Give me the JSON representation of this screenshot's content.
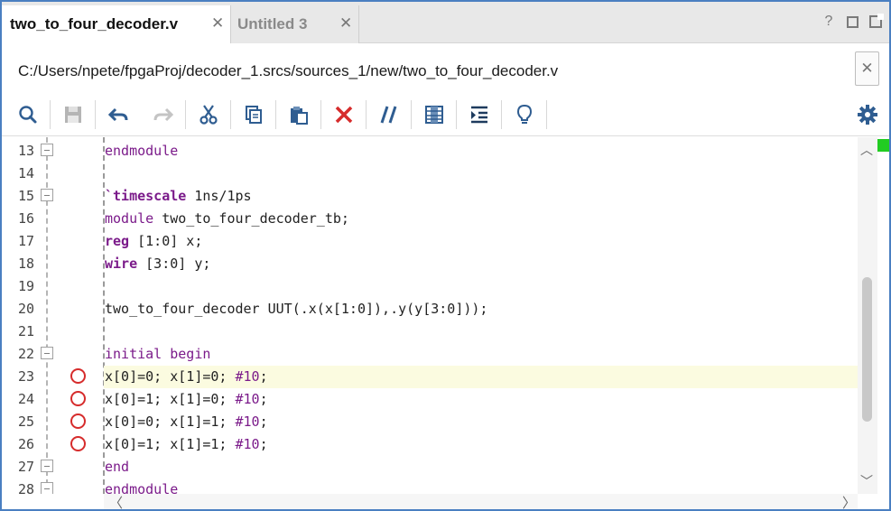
{
  "tabs": [
    {
      "label": "two_to_four_decoder.v",
      "active": true
    },
    {
      "label": "Untitled 3",
      "active": false
    }
  ],
  "window_buttons": {
    "help": "?"
  },
  "path": "C:/Users/npete/fpgaProj/decoder_1.srcs/sources_1/new/two_to_four_decoder.v",
  "toolbar": [
    {
      "name": "search-icon"
    },
    {
      "name": "save-icon"
    },
    {
      "name": "undo-icon"
    },
    {
      "name": "redo-icon"
    },
    {
      "name": "cut-icon"
    },
    {
      "name": "copy-icon"
    },
    {
      "name": "paste-icon"
    },
    {
      "name": "delete-icon"
    },
    {
      "name": "comment-icon"
    },
    {
      "name": "column-icon"
    },
    {
      "name": "indent-icon"
    },
    {
      "name": "lightbulb-icon"
    },
    {
      "name": "gear-icon"
    }
  ],
  "lines": [
    {
      "num": "13",
      "fold": true,
      "bp": false,
      "hl": false,
      "code": [
        [
          "kw",
          "endmodule"
        ]
      ]
    },
    {
      "num": "14",
      "fold": false,
      "bp": false,
      "hl": false,
      "code": []
    },
    {
      "num": "15",
      "fold": true,
      "bp": false,
      "hl": false,
      "code": [
        [
          "kwb",
          "`timescale"
        ],
        [
          "",
          "1ns/1ps"
        ]
      ]
    },
    {
      "num": "16",
      "fold": false,
      "bp": false,
      "hl": false,
      "code": [
        [
          "kw",
          "module"
        ],
        [
          "",
          "two_to_four_decoder_tb;"
        ]
      ]
    },
    {
      "num": "17",
      "fold": false,
      "bp": false,
      "hl": false,
      "code": [
        [
          "kwb",
          "reg"
        ],
        [
          "",
          "[1:0] x;"
        ]
      ]
    },
    {
      "num": "18",
      "fold": false,
      "bp": false,
      "hl": false,
      "code": [
        [
          "kwb",
          "wire"
        ],
        [
          "",
          "[3:0] y;"
        ]
      ]
    },
    {
      "num": "19",
      "fold": false,
      "bp": false,
      "hl": false,
      "code": []
    },
    {
      "num": "20",
      "fold": false,
      "bp": false,
      "hl": false,
      "code": [
        [
          "",
          "two_to_four_decoder UUT(.x(x[1:0]),.y(y[3:0]));"
        ]
      ]
    },
    {
      "num": "21",
      "fold": false,
      "bp": false,
      "hl": false,
      "code": []
    },
    {
      "num": "22",
      "fold": true,
      "bp": false,
      "hl": false,
      "code": [
        [
          "kw",
          "initial begin"
        ]
      ]
    },
    {
      "num": "23",
      "fold": false,
      "bp": true,
      "hl": true,
      "code": [
        [
          "",
          "x[0]=0; x[1]=0;"
        ],
        [
          "num",
          "#10"
        ],
        [
          "",
          ";"
        ]
      ]
    },
    {
      "num": "24",
      "fold": false,
      "bp": true,
      "hl": false,
      "code": [
        [
          "",
          "x[0]=1; x[1]=0;"
        ],
        [
          "num",
          "#10"
        ],
        [
          "",
          ";"
        ]
      ]
    },
    {
      "num": "25",
      "fold": false,
      "bp": true,
      "hl": false,
      "code": [
        [
          "",
          "x[0]=0; x[1]=1;"
        ],
        [
          "num",
          "#10"
        ],
        [
          "",
          ";"
        ]
      ]
    },
    {
      "num": "26",
      "fold": false,
      "bp": true,
      "hl": false,
      "code": [
        [
          "",
          "x[0]=1; x[1]=1;"
        ],
        [
          "num",
          "#10"
        ],
        [
          "",
          ";"
        ]
      ]
    },
    {
      "num": "27",
      "fold": true,
      "bp": false,
      "hl": false,
      "code": [
        [
          "kw",
          "end"
        ]
      ]
    },
    {
      "num": "28",
      "fold": true,
      "bp": false,
      "hl": false,
      "code": [
        [
          "kw",
          "endmodule"
        ]
      ]
    }
  ],
  "colors": {
    "accent": "#4a7fc1",
    "keyword": "#7b1b8a",
    "breakpoint": "#d62c2c",
    "highlight": "#fbfbe0",
    "overview_mark": "#22cc22"
  }
}
